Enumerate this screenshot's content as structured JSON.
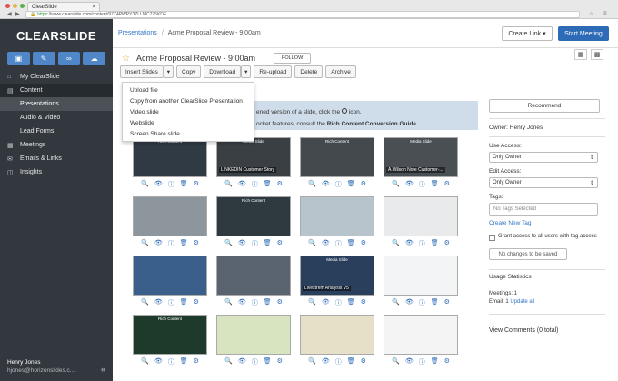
{
  "browser": {
    "tab_title": "ClearSlide",
    "url_scheme": "https",
    "url": "://www.clearslide.com/content/97Z4PWPY3ZLLMC775KDE"
  },
  "sidebar": {
    "logo": "CLEARSLIDE",
    "quick_actions": [
      "presentation-icon",
      "edit-icon",
      "link-icon",
      "cloud-icon"
    ],
    "items": [
      {
        "label": "My ClearSlide",
        "icon": "home-icon"
      },
      {
        "label": "Content",
        "icon": "folder-icon"
      },
      {
        "label": "Presentations"
      },
      {
        "label": "Audio & Video"
      },
      {
        "label": "Lead Forms"
      },
      {
        "label": "Meetings",
        "icon": "meeting-icon"
      },
      {
        "label": "Emails & Links",
        "icon": "email-icon"
      },
      {
        "label": "Insights",
        "icon": "chart-icon"
      }
    ],
    "user_name": "Henry Jones",
    "user_email": "hjones@horizonslides.c..."
  },
  "header": {
    "breadcrumb_root": "Presentations",
    "breadcrumb_current": "Acme Proposal Review - 9:00am",
    "create_link": "Create Link",
    "start_meeting": "Start Meeting"
  },
  "presentation": {
    "title": "Acme Proposal Review - 9:00am",
    "follow": "FOLLOW"
  },
  "toolbar": {
    "insert": "Insert Slides",
    "copy": "Copy",
    "download": "Download",
    "reupload": "Re-upload",
    "delete": "Delete",
    "archive": "Archive"
  },
  "insert_menu": [
    "Upload file",
    "Copy from another ClearSlide Presentation",
    "Video slide",
    "Webslide",
    "Screen Share slide"
  ],
  "info": {
    "line1_pre": "ened version of a slide, click the ",
    "line1_post": " icon.",
    "line2_pre": "ocket features, consult the ",
    "line2_link": "Rich Content Conversion Guide."
  },
  "slides": [
    {
      "label": "Rich Content",
      "caption": ""
    },
    {
      "label": "Media Slide",
      "caption": "LINKEDIN Customer Story"
    },
    {
      "label": "Rich Content",
      "caption": ""
    },
    {
      "label": "Media Slide",
      "caption": "A.Wilson Note Customer-..."
    },
    {
      "label": "",
      "caption": ""
    },
    {
      "label": "Rich Content",
      "caption": ""
    },
    {
      "label": "",
      "caption": ""
    },
    {
      "label": "",
      "caption": ""
    },
    {
      "label": "",
      "caption": ""
    },
    {
      "label": "",
      "caption": ""
    },
    {
      "label": "Media Slide",
      "caption": "Livestrem Analysis V5"
    },
    {
      "label": "",
      "caption": ""
    },
    {
      "label": "Rich Content",
      "caption": ""
    },
    {
      "label": "",
      "caption": ""
    },
    {
      "label": "",
      "caption": ""
    },
    {
      "label": "",
      "caption": ""
    }
  ],
  "right_panel": {
    "recommend": "Recommend",
    "owner": "Owner: Henry Jones",
    "use_access_label": "Use Access:",
    "use_access_value": "Only Owner",
    "edit_access_label": "Edit Access:",
    "edit_access_value": "Only Owner",
    "tags_label": "Tags:",
    "tags_placeholder": "No Tags Selected",
    "create_tag": "Create New Tag",
    "grant_access": "Grant access to all users with tag access",
    "no_changes": "No changes to be saved",
    "usage_title": "Usage Statistics",
    "meetings": "Meetings: 1",
    "email_prefix": "Email: 1",
    "update_all": "Update all",
    "view_comments": "View Comments (0 total)"
  },
  "colors": {
    "sidebar": "#32383e",
    "accent": "#2e6bb7",
    "info_bg": "#cfdcea"
  }
}
